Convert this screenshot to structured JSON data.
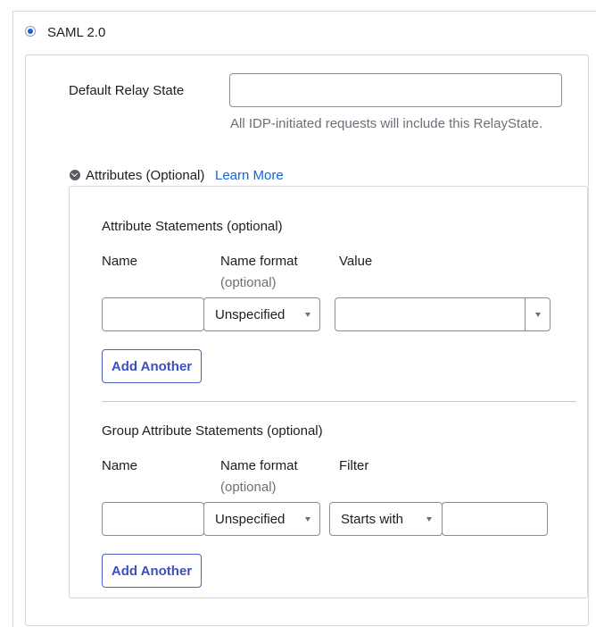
{
  "saml_option": {
    "label": "SAML 2.0",
    "selected": true
  },
  "relay_state": {
    "label": "Default Relay State",
    "value": "",
    "hint": "All IDP-initiated requests will include this RelayState."
  },
  "attributes": {
    "toggle_label": "Attributes (Optional)",
    "learn_more": "Learn More",
    "attribute_statements": {
      "title": "Attribute Statements (optional)",
      "col_name": "Name",
      "col_format": "Name format",
      "col_format_sub": "(optional)",
      "col_value": "Value",
      "name_value": "",
      "format_selected": "Unspecified",
      "value_selected": "",
      "add_button": "Add Another"
    },
    "group_attribute_statements": {
      "title": "Group Attribute Statements (optional)",
      "col_name": "Name",
      "col_format": "Name format",
      "col_format_sub": "(optional)",
      "col_filter": "Filter",
      "name_value": "",
      "format_selected": "Unspecified",
      "filter_selected": "Starts with",
      "filter_value": "",
      "add_button": "Add Another"
    }
  },
  "colors": {
    "accent": "#1662dd",
    "button_border": "#4b5fc8",
    "border": "#d7d7dc"
  }
}
